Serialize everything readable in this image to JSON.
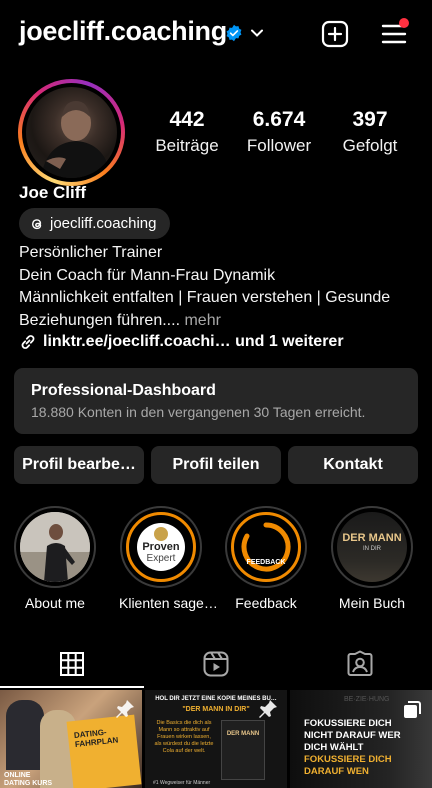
{
  "header": {
    "username": "joecliff.coaching"
  },
  "stats": [
    {
      "value": "442",
      "label": "Beiträge"
    },
    {
      "value": "6.674",
      "label": "Follower"
    },
    {
      "value": "397",
      "label": "Gefolgt"
    }
  ],
  "profile": {
    "name": "Joe Cliff",
    "threads_handle": "joecliff.coaching",
    "bio_lines": [
      "Persönlicher Trainer",
      "Dein Coach für Mann-Frau Dynamik",
      "Männlichkeit entfalten | Frauen verstehen | Gesunde",
      "Beziehungen führen...."
    ],
    "more_label": "mehr",
    "link_text": "linktr.ee/joecliff.coachi… und 1 weiterer"
  },
  "dashboard": {
    "title": "Professional-Dashboard",
    "subtitle": "18.880 Konten in den vergangenen 30 Tagen erreicht."
  },
  "buttons": {
    "edit": "Profil bearbe…",
    "share": "Profil teilen",
    "contact": "Kontakt"
  },
  "highlights": [
    {
      "label": "About me",
      "icon": "person-photo"
    },
    {
      "label": "Klienten sage…",
      "icon": "proven-expert-logo",
      "logo_line1": "Proven",
      "logo_line2": "Expert"
    },
    {
      "label": "Feedback",
      "icon": "feedback-ring",
      "inner_text": "FEEDBACK"
    },
    {
      "label": "Mein Buch",
      "icon": "book-cover",
      "inner_title": "DER MANN",
      "inner_sub": "IN DIR"
    }
  ],
  "tabs": [
    {
      "name": "grid-icon",
      "active": true
    },
    {
      "name": "reels-icon",
      "active": false
    },
    {
      "name": "tagged-icon",
      "active": false
    }
  ],
  "posts": [
    {
      "caption_a": "ONLINE",
      "caption_b": "DATING KURS",
      "book_label": "DATING-FAHRPLAN"
    },
    {
      "headline": "HOL DIR JETZT EINE KOPIE MEINES BU…",
      "subhead": "\"DER MANN IN DIR\"",
      "body": "Die Basics die dich als Mann so attraktiv auf Frauen wirken lassen, als würdest du die letzte Cola auf der welt.",
      "book_label": "DER MANN",
      "footer": "#1 Wegweiser für Männer"
    },
    {
      "line1": "FOKUSSIERE DICH",
      "line2": "NICHT DARAUF WER",
      "line3": "DICH WÄHLT",
      "line4": "FOKUSSIERE DICH",
      "line5": "DARAUF WEN",
      "top_text": "BE·ZIE·HUNG"
    }
  ],
  "colors": {
    "background": "#000000",
    "surface": "#262626",
    "verified": "#0095f6",
    "notification": "#ff3040",
    "accent_orange": "#f08a00"
  }
}
